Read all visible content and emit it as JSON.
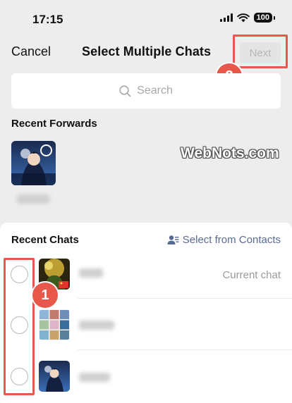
{
  "status": {
    "time": "17:15",
    "battery": "100"
  },
  "nav": {
    "cancel": "Cancel",
    "title": "Select Multiple Chats",
    "next": "Next"
  },
  "search": {
    "placeholder": "Search"
  },
  "recent_forwards": {
    "label": "Recent Forwards"
  },
  "watermark": "WebNots.com",
  "recent_chats": {
    "label": "Recent Chats",
    "select_from_contacts": "Select from Contacts",
    "current_chat_label": "Current chat"
  },
  "annotations": {
    "badge_1": "1",
    "badge_2": "2"
  },
  "colors": {
    "annotation": "#e8584a",
    "link": "#576b95",
    "next_disabled_bg": "#e4e4e4"
  }
}
